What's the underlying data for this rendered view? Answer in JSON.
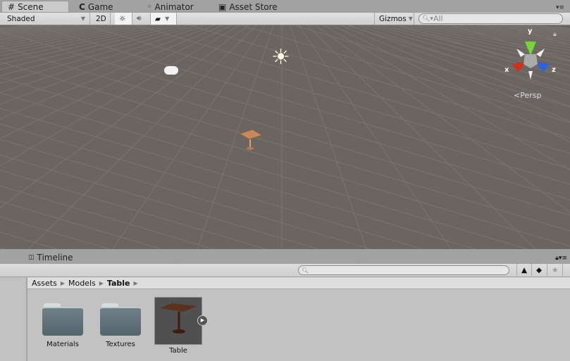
{
  "tabs": [
    {
      "label": "Scene",
      "icon": "grid-icon",
      "active": true
    },
    {
      "label": "Game",
      "icon": "pacman-icon"
    },
    {
      "label": "Animator",
      "icon": "animator-icon"
    },
    {
      "label": "Asset Store",
      "icon": "store-icon"
    }
  ],
  "scene_toolbar": {
    "shading": "Shaded",
    "mode_2d": "2D",
    "gizmos": "Gizmos",
    "search_placeholder": "All"
  },
  "gizmo": {
    "x": "x",
    "y": "y",
    "z": "z",
    "projection": "Persp"
  },
  "colors": {
    "x_axis": "#c8321e",
    "y_axis": "#7ad23a",
    "z_axis": "#2f62d8",
    "viewport": "#6b6561"
  },
  "timeline_tab": {
    "label": "Timeline"
  },
  "project": {
    "search_placeholder": "",
    "breadcrumb": [
      "Assets",
      "Models",
      "Table"
    ],
    "assets": [
      {
        "name": "Materials",
        "type": "folder"
      },
      {
        "name": "Textures",
        "type": "folder"
      },
      {
        "name": "Table",
        "type": "model"
      }
    ]
  }
}
